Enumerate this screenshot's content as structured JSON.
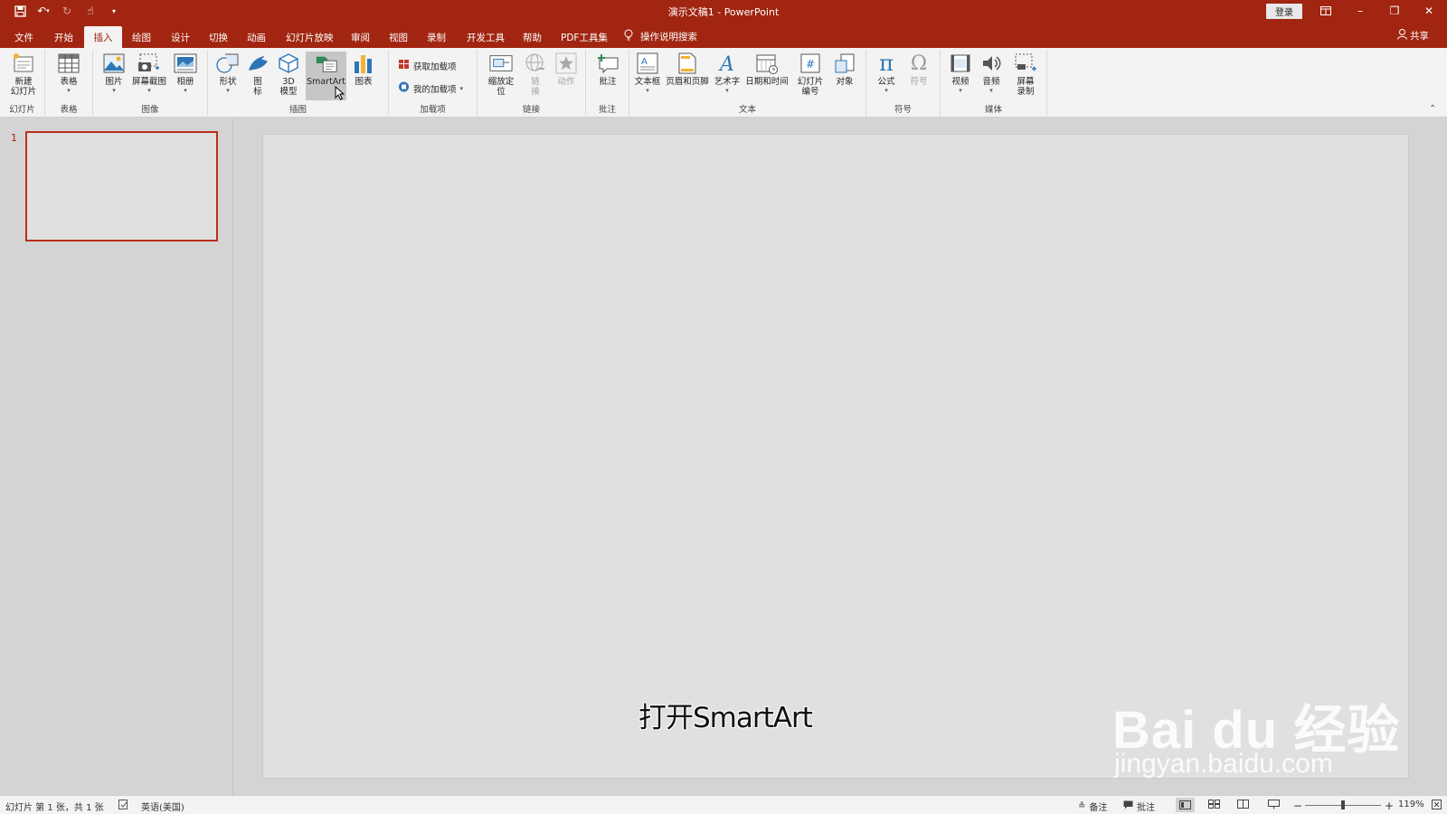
{
  "app": {
    "window_title": "演示文稿1 - PowerPoint",
    "login_label": "登录",
    "share_label": "共享",
    "accent": "#a12510"
  },
  "qat": [
    "save-icon",
    "undo-icon",
    "redo-icon",
    "touch-mode-icon",
    "customize-qat-icon"
  ],
  "tabs": [
    "文件",
    "开始",
    "插入",
    "绘图",
    "设计",
    "切换",
    "动画",
    "幻灯片放映",
    "审阅",
    "视图",
    "录制",
    "开发工具",
    "帮助",
    "PDF工具集"
  ],
  "active_tab": "插入",
  "tell_me": "操作说明搜索",
  "ribbon": {
    "groups": {
      "slides": "幻灯片",
      "tables": "表格",
      "images": "图像",
      "illustrations": "插图",
      "addins": "加载项",
      "links": "链接",
      "comments": "批注",
      "text": "文本",
      "symbols": "符号",
      "media": "媒体"
    },
    "buttons": {
      "new_slide_1": "新建",
      "new_slide_2": "幻灯片",
      "table": "表格",
      "pictures": "图片",
      "screenshot": "屏幕截图",
      "album": "相册",
      "shapes": "形状",
      "icons_1": "图",
      "icons_2": "标",
      "model3d_1": "3D",
      "model3d_2": "模型",
      "smartart": "SmartArt",
      "chart": "图表",
      "get_addins": "获取加载项",
      "my_addins": "我的加载项",
      "zoom_1": "缩放定",
      "zoom_2": "位",
      "link_1": "链",
      "link_2": "接",
      "action": "动作",
      "comment": "批注",
      "textbox": "文本框",
      "header_footer": "页眉和页脚",
      "wordart": "艺术字",
      "date_time": "日期和时间",
      "slide_number_1": "幻灯片",
      "slide_number_2": "编号",
      "object": "对象",
      "equation": "公式",
      "symbol": "符号",
      "video": "视频",
      "audio": "音频",
      "screen_rec_1": "屏幕",
      "screen_rec_2": "录制"
    }
  },
  "thumbnails": [
    {
      "number": "1"
    }
  ],
  "slide": {
    "caption": "打开SmartArt",
    "watermark_main": "Bai du 经验",
    "watermark_url": "jingyan.baidu.com"
  },
  "status": {
    "slide_info": "幻灯片 第 1 张，共 1 张",
    "language": "英语(美国)",
    "notes": "备注",
    "comments": "批注",
    "zoom_minus": "−",
    "zoom_plus": "+",
    "zoom_level": "119%"
  }
}
